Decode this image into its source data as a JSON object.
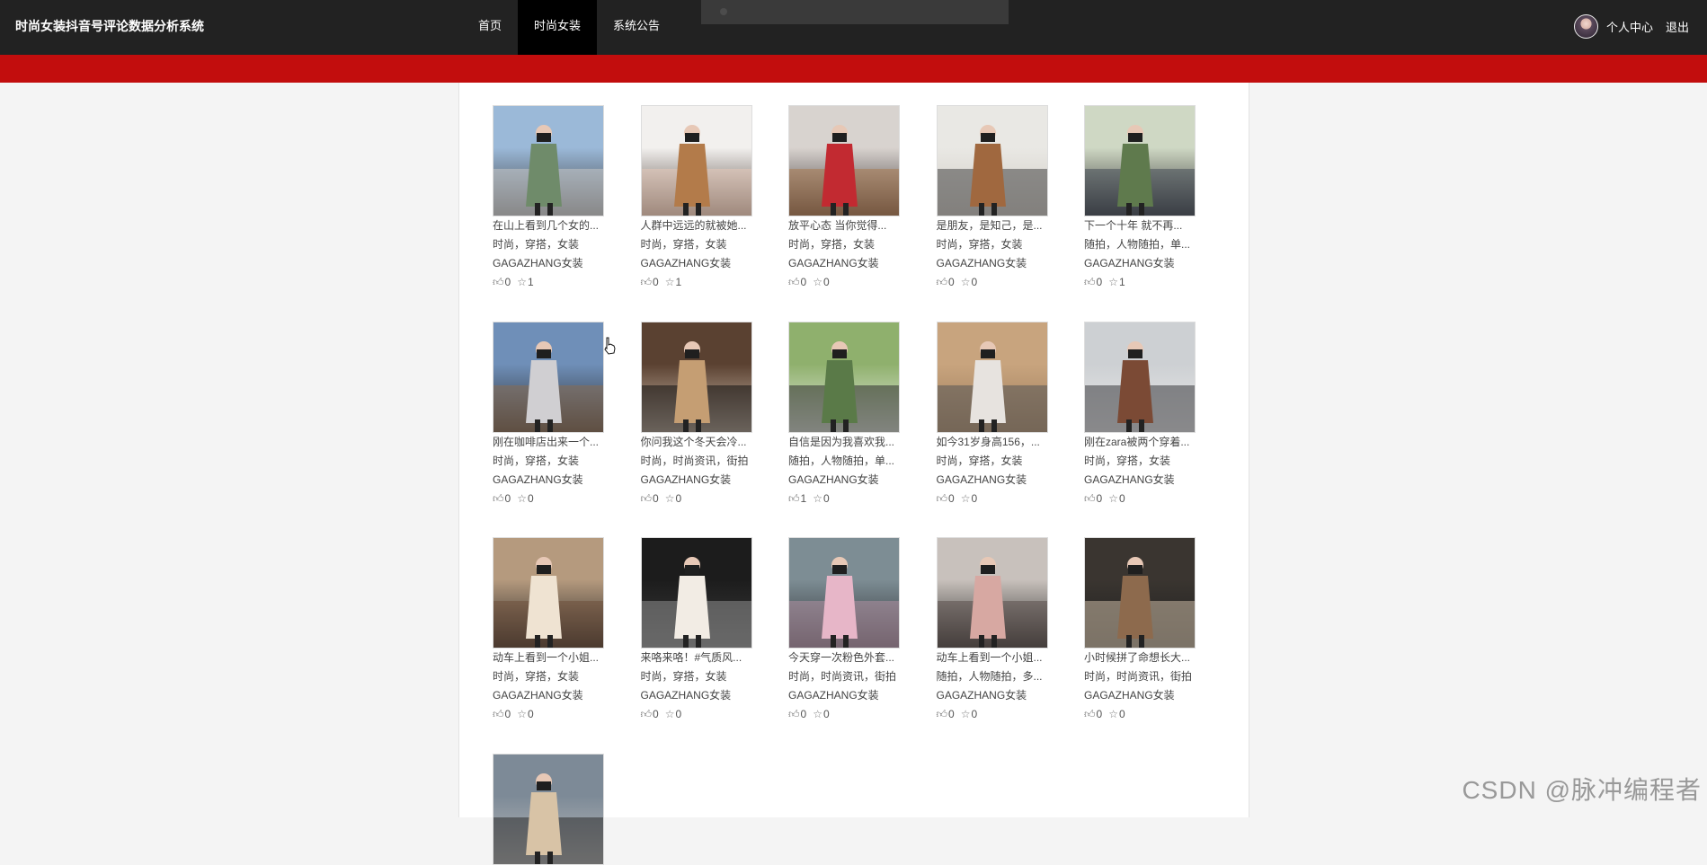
{
  "header": {
    "site_title": "时尚女装抖音号评论数据分析系统",
    "nav": [
      {
        "label": "首页",
        "active": false
      },
      {
        "label": "时尚女装",
        "active": true
      },
      {
        "label": "系统公告",
        "active": false
      }
    ],
    "user_center": "个人中心",
    "logout": "退出"
  },
  "videos": [
    {
      "title": "在山上看到几个女的...",
      "tags": "时尚，穿搭，女装",
      "account": "GAGAZHANG女装",
      "likes": "0",
      "stars": "1"
    },
    {
      "title": "人群中远远的就被她...",
      "tags": "时尚，穿搭，女装",
      "account": "GAGAZHANG女装",
      "likes": "0",
      "stars": "1"
    },
    {
      "title": "放平心态 当你觉得...",
      "tags": "时尚，穿搭，女装",
      "account": "GAGAZHANG女装",
      "likes": "0",
      "stars": "0"
    },
    {
      "title": "是朋友，是知己，是...",
      "tags": "时尚，穿搭，女装",
      "account": "GAGAZHANG女装",
      "likes": "0",
      "stars": "0"
    },
    {
      "title": "下一个十年 就不再...",
      "tags": "随拍，人物随拍，单...",
      "account": "GAGAZHANG女装",
      "likes": "0",
      "stars": "1"
    },
    {
      "title": "刚在咖啡店出来一个...",
      "tags": "时尚，穿搭，女装",
      "account": "GAGAZHANG女装",
      "likes": "0",
      "stars": "0"
    },
    {
      "title": "你问我这个冬天会冷...",
      "tags": "时尚，时尚资讯，街拍",
      "account": "GAGAZHANG女装",
      "likes": "0",
      "stars": "0"
    },
    {
      "title": "自信是因为我喜欢我...",
      "tags": "随拍，人物随拍，单...",
      "account": "GAGAZHANG女装",
      "likes": "1",
      "stars": "0"
    },
    {
      "title": "如今31岁身高156，...",
      "tags": "时尚，穿搭，女装",
      "account": "GAGAZHANG女装",
      "likes": "0",
      "stars": "0"
    },
    {
      "title": "刚在zara被两个穿着...",
      "tags": "时尚，穿搭，女装",
      "account": "GAGAZHANG女装",
      "likes": "0",
      "stars": "0"
    },
    {
      "title": "动车上看到一个小姐...",
      "tags": "时尚，穿搭，女装",
      "account": "GAGAZHANG女装",
      "likes": "0",
      "stars": "0"
    },
    {
      "title": "来咯来咯！#气质风...",
      "tags": "时尚，穿搭，女装",
      "account": "GAGAZHANG女装",
      "likes": "0",
      "stars": "0"
    },
    {
      "title": "今天穿一次粉色外套...",
      "tags": "时尚，时尚资讯，街拍",
      "account": "GAGAZHANG女装",
      "likes": "0",
      "stars": "0"
    },
    {
      "title": "动车上看到一个小姐...",
      "tags": "随拍，人物随拍，多...",
      "account": "GAGAZHANG女装",
      "likes": "0",
      "stars": "0"
    },
    {
      "title": "小时候拼了命想长大...",
      "tags": "时尚，时尚资讯，街拍",
      "account": "GAGAZHANG女装",
      "likes": "0",
      "stars": "0"
    },
    {
      "title": "",
      "tags": "",
      "account": "",
      "likes": "",
      "stars": ""
    }
  ],
  "icons": {
    "like": "thumbs-up-icon",
    "star": "star-icon"
  },
  "colors": {
    "topbar": "#222222",
    "accent_bar": "#c20d0d",
    "active_nav": "#000000"
  },
  "watermark": "CSDN @脉冲编程者"
}
